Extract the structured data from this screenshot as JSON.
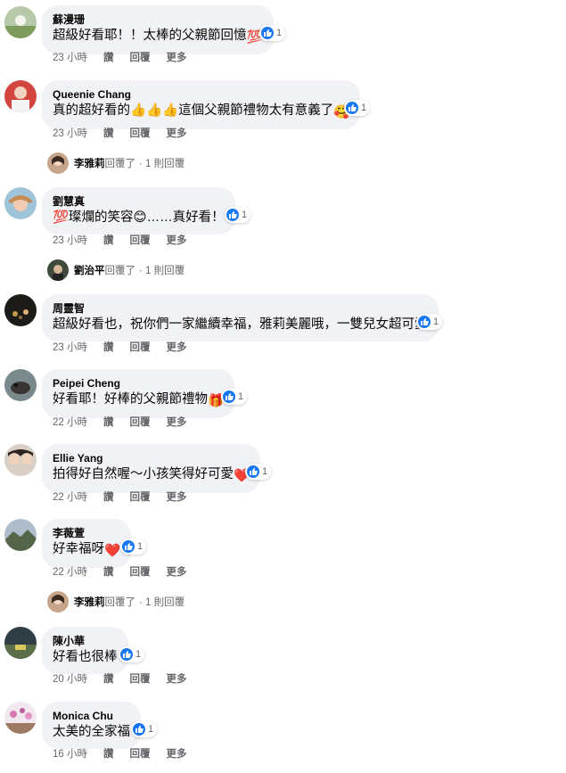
{
  "comments": [
    {
      "name": "蘇漫珊",
      "text": "超級好看耶！！太棒的父親節回憶",
      "emoji": "💯",
      "likes": "1",
      "time": "23 小時",
      "a1": "讚",
      "a2": "回覆",
      "a3": "更多"
    },
    {
      "name": "Queenie Chang",
      "text": "真的超好看的👍👍👍這個父親節禮物太有意義了",
      "emoji": "🥰",
      "likes": "1",
      "time": "23 小時",
      "a1": "讚",
      "a2": "回覆",
      "a3": "更多"
    },
    {
      "name": "劉慧真",
      "text": "💯璨爛的笑容😊……真好看！",
      "emoji": "",
      "likes": "1",
      "time": "23 小時",
      "a1": "讚",
      "a2": "回覆",
      "a3": "更多"
    },
    {
      "name": "周靈智",
      "text": "超級好看也，祝你們一家繼續幸福，雅莉美麗哦，一雙兒女超可愛",
      "emoji": "",
      "likes": "1",
      "time": "23 小時",
      "a1": "讚",
      "a2": "回覆",
      "a3": "更多"
    },
    {
      "name": "Peipei Cheng",
      "text": "好看耶！好棒的父親節禮物",
      "emoji": "🎁",
      "likes": "1",
      "time": "22 小時",
      "a1": "讚",
      "a2": "回覆",
      "a3": "更多"
    },
    {
      "name": "Ellie Yang",
      "text": "拍得好自然喔～小孩笑得好可愛",
      "emoji": "❤️",
      "likes": "1",
      "time": "22 小時",
      "a1": "讚",
      "a2": "回覆",
      "a3": "更多"
    },
    {
      "name": "李薇萱",
      "text": "好幸福呀",
      "emoji": "❤️",
      "likes": "1",
      "time": "22 小時",
      "a1": "讚",
      "a2": "回覆",
      "a3": "更多"
    },
    {
      "name": "陳小華",
      "text": "好看也很棒",
      "emoji": "",
      "likes": "1",
      "time": "20 小時",
      "a1": "讚",
      "a2": "回覆",
      "a3": "更多"
    },
    {
      "name": "Monica Chu",
      "text": "太美的全家福",
      "emoji": "",
      "likes": "1",
      "time": "16 小時",
      "a1": "讚",
      "a2": "回覆",
      "a3": "更多"
    }
  ],
  "replies": [
    {
      "name": "李雅莉",
      "action": "回覆了",
      "count": "· 1 則回覆"
    },
    {
      "name": "劉治平",
      "action": "回覆了",
      "count": "· 1 則回覆"
    },
    {
      "name": "李雅莉",
      "action": "回覆了",
      "count": "· 1 則回覆"
    }
  ],
  "colors": {
    "like": "#1877f2",
    "bubble": "#f0f2f5",
    "meta": "#65676b"
  }
}
